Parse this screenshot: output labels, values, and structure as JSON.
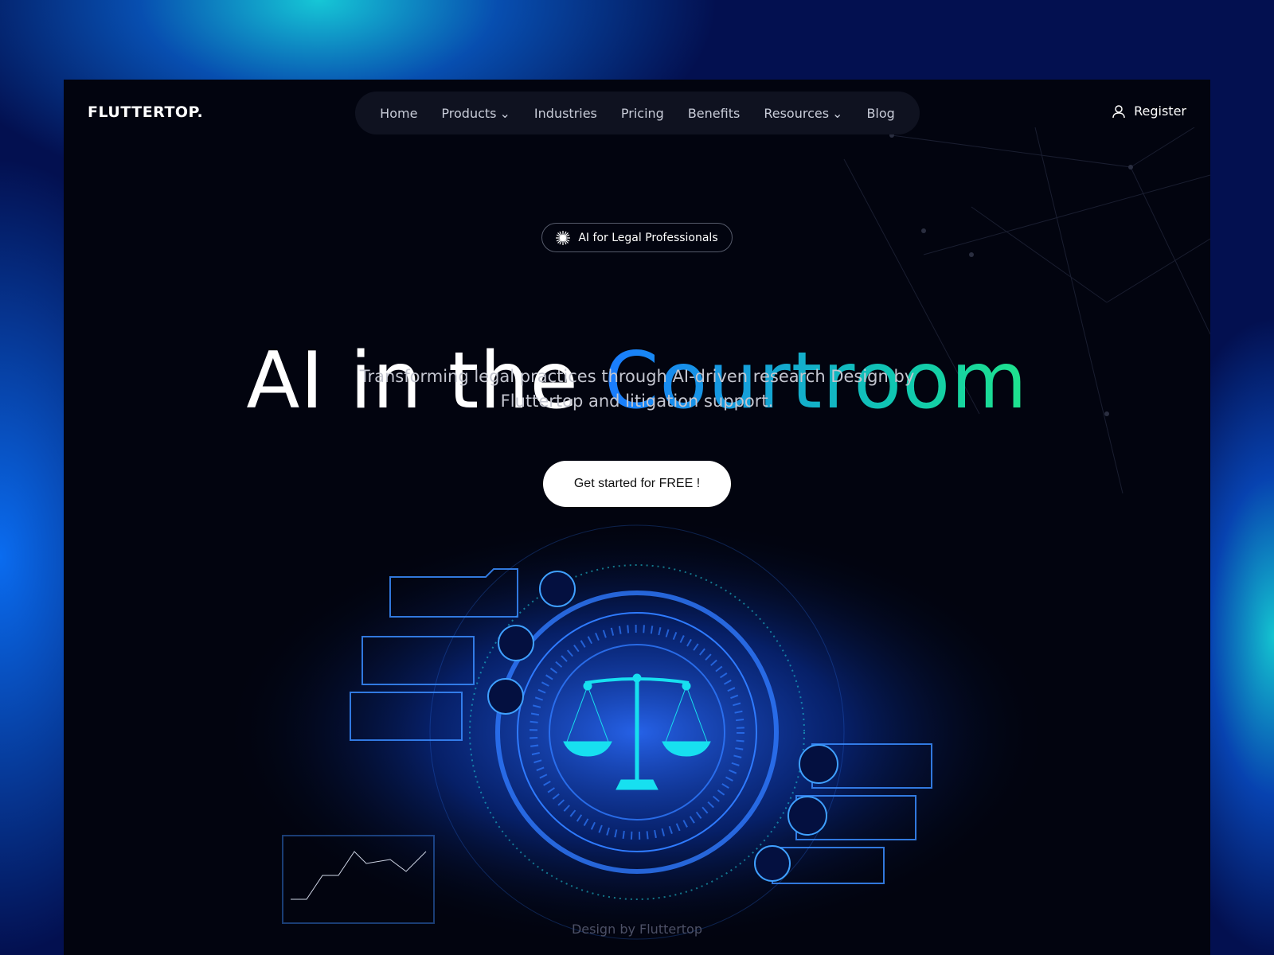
{
  "brand": {
    "logo": "FLUTTERTOP."
  },
  "nav": {
    "items": [
      {
        "label": "Home",
        "active": true
      },
      {
        "label": "Products",
        "dropdown": true
      },
      {
        "label": "Industries"
      },
      {
        "label": "Pricing"
      },
      {
        "label": "Benefits"
      },
      {
        "label": "Resources",
        "dropdown": true
      },
      {
        "label": "Blog"
      }
    ]
  },
  "header": {
    "register": "Register",
    "register_icon": "user-icon"
  },
  "hero": {
    "badge": "AI for Legal Professionals",
    "badge_icon": "sparkle-icon",
    "title_plain": "AI in the",
    "title_highlight": "Courtroom",
    "subtitle_line1": "Transforming legal practices through AI-driven research Design by",
    "subtitle_line2": "Fluttertop and litigation support.",
    "cta": "Get started for FREE !"
  },
  "illustration": {
    "icons": [
      "search-icon",
      "notes-icon",
      "person-podium-icon",
      "gavel-icon",
      "courthouse-icon",
      "document-icon"
    ],
    "center_icon": "scales-of-justice-icon"
  },
  "footer": {
    "credit": "Design by Fluttertop"
  },
  "colors": {
    "accent_start": "#1a7bff",
    "accent_end": "#1fe38c",
    "background": "#02040f",
    "nav_bg": "#0f1220"
  }
}
